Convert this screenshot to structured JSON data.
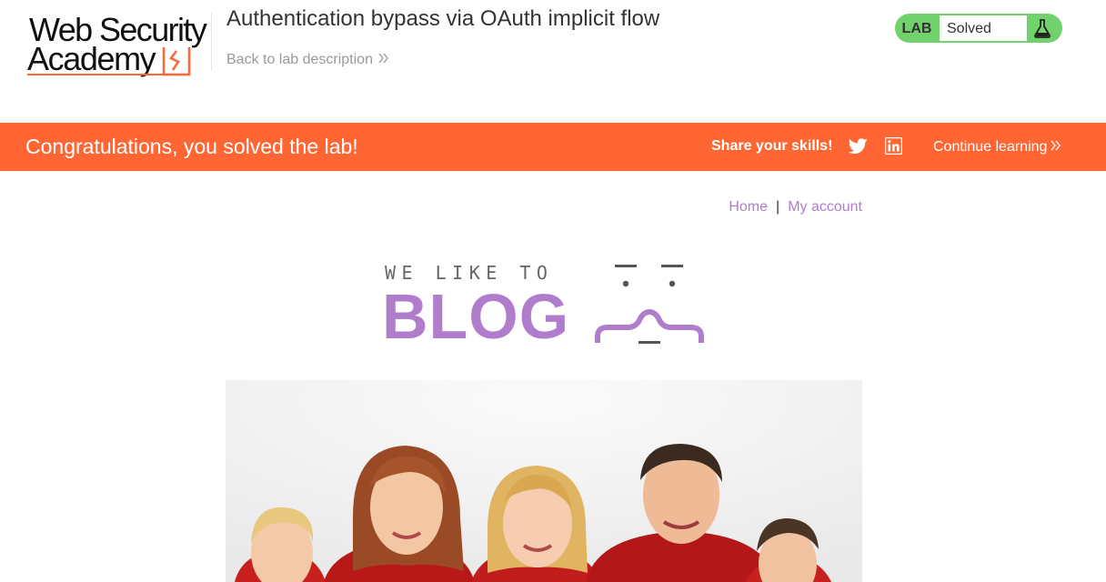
{
  "academy": {
    "logo_line1": "Web Security",
    "logo_line2": "Academy",
    "lab_title": "Authentication bypass via OAuth implicit flow",
    "back_link_label": "Back to lab description",
    "lab_badge_label": "LAB",
    "lab_status": "Solved",
    "accent_color": "#ff6633",
    "solved_color": "#70d16d"
  },
  "banner": {
    "message": "Congratulations, you solved the lab!",
    "share_label": "Share your skills!",
    "continue_label": "Continue learning"
  },
  "blog_nav": {
    "home": "Home",
    "separator": "|",
    "my_account": "My account",
    "link_color": "#b07dcc"
  },
  "blog_banner": {
    "tagline": "WE LIKE TO",
    "word": "BLOG"
  },
  "hero": {
    "icon": "family-photo-image"
  }
}
